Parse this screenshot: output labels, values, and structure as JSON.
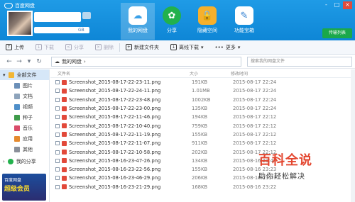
{
  "app": {
    "title": "百度网盘",
    "quota_suffix": "GB"
  },
  "window_buttons": [
    "-",
    "□",
    "×"
  ],
  "nav": [
    {
      "label": "我的网盘",
      "icon": "cloud-icon"
    },
    {
      "label": "分享",
      "icon": "share-icon"
    },
    {
      "label": "隐藏空间",
      "icon": "lock-icon"
    },
    {
      "label": "功能宝箱",
      "icon": "toolbox-icon"
    }
  ],
  "upgrade_label": "传输列表",
  "toolbar": {
    "upload": "上传",
    "download": "下载",
    "share": "分享",
    "delete": "删除",
    "new_folder": "新建文件夹",
    "offline": "离线下载",
    "more": "更多"
  },
  "address": {
    "path": "我的网盘",
    "search_placeholder": "搜索我的网盘文件"
  },
  "sidebar": {
    "all_files": "全部文件",
    "items": [
      "图片",
      "文档",
      "视频",
      "种子",
      "音乐",
      "应用",
      "其他"
    ],
    "my_share": "我的分享"
  },
  "promo": {
    "title": "百度网盘",
    "big": "超级会员",
    "small": "百度网盘"
  },
  "columns": {
    "name": "文件名",
    "size": "大小",
    "date": "修改时间"
  },
  "files": [
    {
      "name": "Screenshot_2015-08-17-22-23-11.png",
      "size": "191KB",
      "date": "2015-08-17 22:24"
    },
    {
      "name": "Screenshot_2015-08-17-22-24-11.png",
      "size": "1.01MB",
      "date": "2015-08-17 22:24"
    },
    {
      "name": "Screenshot_2015-08-17-22-23-48.png",
      "size": "1002KB",
      "date": "2015-08-17 22:24"
    },
    {
      "name": "Screenshot_2015-08-17-22-23-00.png",
      "size": "135KB",
      "date": "2015-08-17 22:24"
    },
    {
      "name": "Screenshot_2015-08-17-22-11-46.png",
      "size": "194KB",
      "date": "2015-08-17 22:12"
    },
    {
      "name": "Screenshot_2015-08-17-22-10-40.png",
      "size": "759KB",
      "date": "2015-08-17 22:12"
    },
    {
      "name": "Screenshot_2015-08-17-22-11-19.png",
      "size": "155KB",
      "date": "2015-08-17 22:12"
    },
    {
      "name": "Screenshot_2015-08-17-22-11-07.png",
      "size": "911KB",
      "date": "2015-08-17 22:12"
    },
    {
      "name": "Screenshot_2015-08-17-22-10-58.png",
      "size": "202KB",
      "date": "2015-08-17 22:12"
    },
    {
      "name": "Screenshot_2015-08-16-23-47-26.png",
      "size": "134KB",
      "date": "2015-08-16 23:48"
    },
    {
      "name": "Screenshot_2015-08-16-23-22-56.png",
      "size": "155KB",
      "date": "2015-08-16 23:23"
    },
    {
      "name": "Screenshot_2015-08-16-23-46-29.png",
      "size": "206KB",
      "date": "2015-08-16 23:47"
    },
    {
      "name": "Screenshot_2015-08-16-23-21-29.png",
      "size": "168KB",
      "date": "2015-08-16 23:22"
    }
  ],
  "watermark": {
    "line1": "百科全说",
    "line2": "助你轻松解决"
  }
}
